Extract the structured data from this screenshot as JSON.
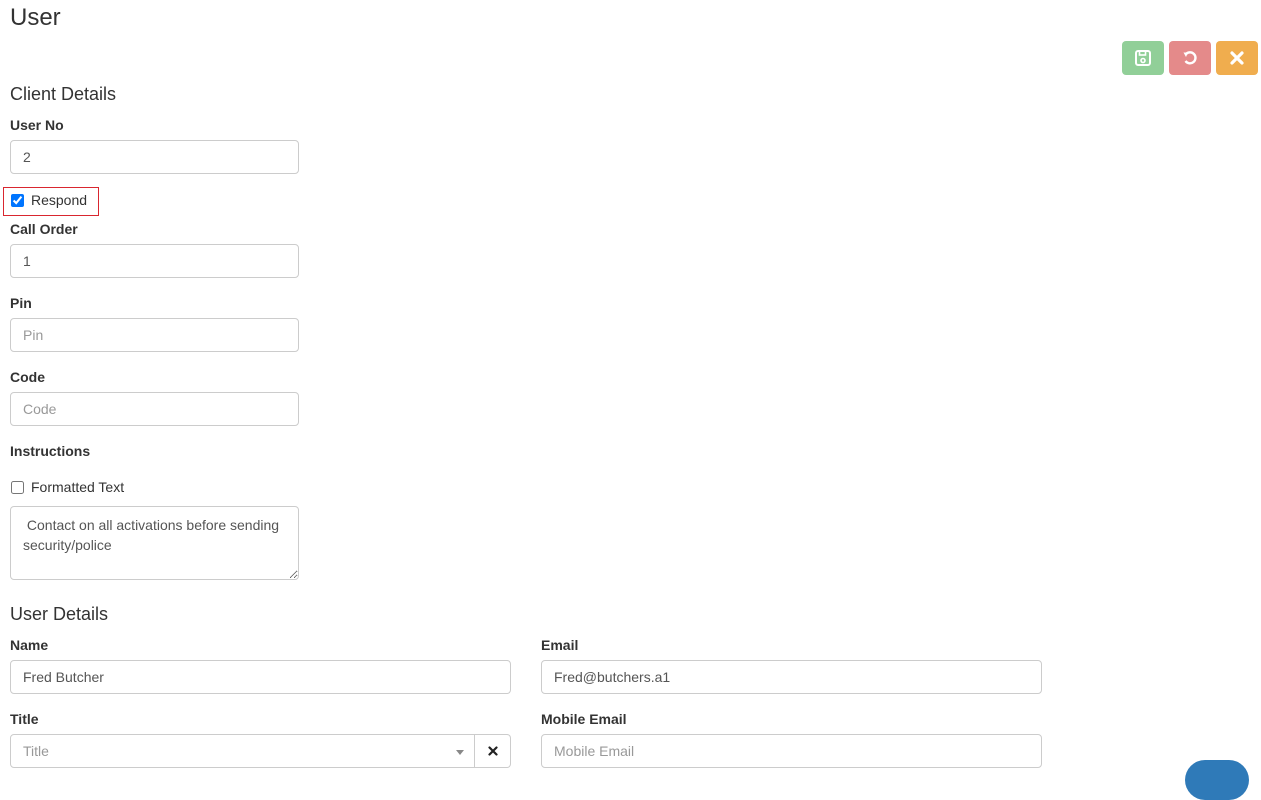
{
  "page": {
    "title": "User"
  },
  "toolbar": {
    "save": {
      "icon": "floppy-disk-icon",
      "color": "#91cf98"
    },
    "undo": {
      "icon": "undo-icon",
      "color": "#e48a8a"
    },
    "close": {
      "icon": "close-icon",
      "color": "#f0ad4e"
    }
  },
  "client_details": {
    "heading": "Client Details",
    "user_no": {
      "label": "User No",
      "value": "2"
    },
    "respond": {
      "label": "Respond",
      "checked": true
    },
    "call_order": {
      "label": "Call Order",
      "value": "1"
    },
    "pin": {
      "label": "Pin",
      "value": "",
      "placeholder": "Pin"
    },
    "code": {
      "label": "Code",
      "value": "",
      "placeholder": "Code"
    },
    "instructions": {
      "label": "Instructions",
      "formatted_text": {
        "label": "Formatted Text",
        "checked": false
      },
      "value": " Contact on all activations before sending security/police"
    }
  },
  "user_details": {
    "heading": "User Details",
    "name": {
      "label": "Name",
      "value": "Fred Butcher"
    },
    "email": {
      "label": "Email",
      "value": "Fred@butchers.a1"
    },
    "title": {
      "label": "Title",
      "placeholder": "Title",
      "value": ""
    },
    "mobile_email": {
      "label": "Mobile Email",
      "value": "",
      "placeholder": "Mobile Email"
    }
  },
  "chat_widget": {
    "icon": "chat-icon",
    "color": "#2f7ab8"
  }
}
